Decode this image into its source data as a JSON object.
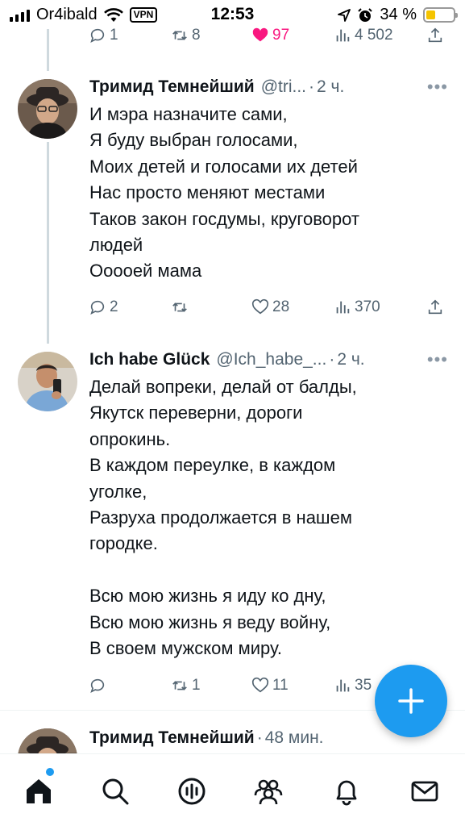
{
  "status_bar": {
    "carrier": "Or4ibald",
    "vpn": "VPN",
    "time": "12:53",
    "battery": "34 %",
    "battery_level_percent": 34
  },
  "top_actions": {
    "replies": "1",
    "retweets": "8",
    "likes": "97",
    "views": "4 502",
    "like_color": "#f91880"
  },
  "tweets": [
    {
      "name": "Тримид Темнейший",
      "handle": "@tri...",
      "dot": "·",
      "time": "2 ч.",
      "more": "•••",
      "lines": [
        "И мэра назначите сами,",
        "Я буду выбран голосами,",
        "Моих детей и голосами их детей",
        "Нас просто меняют местами",
        "Таков закон госдумы, круговорот",
        "людей",
        "Ооооей мама"
      ],
      "replies": "2",
      "retweets": "",
      "likes": "28",
      "views": "370"
    },
    {
      "name": "Ich habe Glück",
      "handle": "@Ich_habe_...",
      "dot": "·",
      "time": "2 ч.",
      "more": "•••",
      "lines": [
        "Делай вопреки, делай от балды,",
        "Якутск переверни, дороги",
        "опрокинь.",
        "В каждом переулке, в каждом",
        "уголке,",
        "Разруха продолжается в нашем",
        "городке.",
        "",
        "Всю мою жизнь я иду ко дну,",
        "Всю мою жизнь я веду войну,",
        "В своем мужском миру."
      ],
      "replies": "",
      "retweets": "1",
      "likes": "11",
      "views": "35"
    },
    {
      "name": "Тримид Темнейший",
      "dot": "·",
      "time": "48 мин."
    }
  ],
  "tab_bar": {
    "items": [
      "home-icon",
      "search-icon",
      "spaces-icon",
      "communities-icon",
      "notifications-icon",
      "messages-icon"
    ]
  },
  "colors": {
    "accent": "#1d9bf0",
    "secondary_text": "#536471"
  }
}
